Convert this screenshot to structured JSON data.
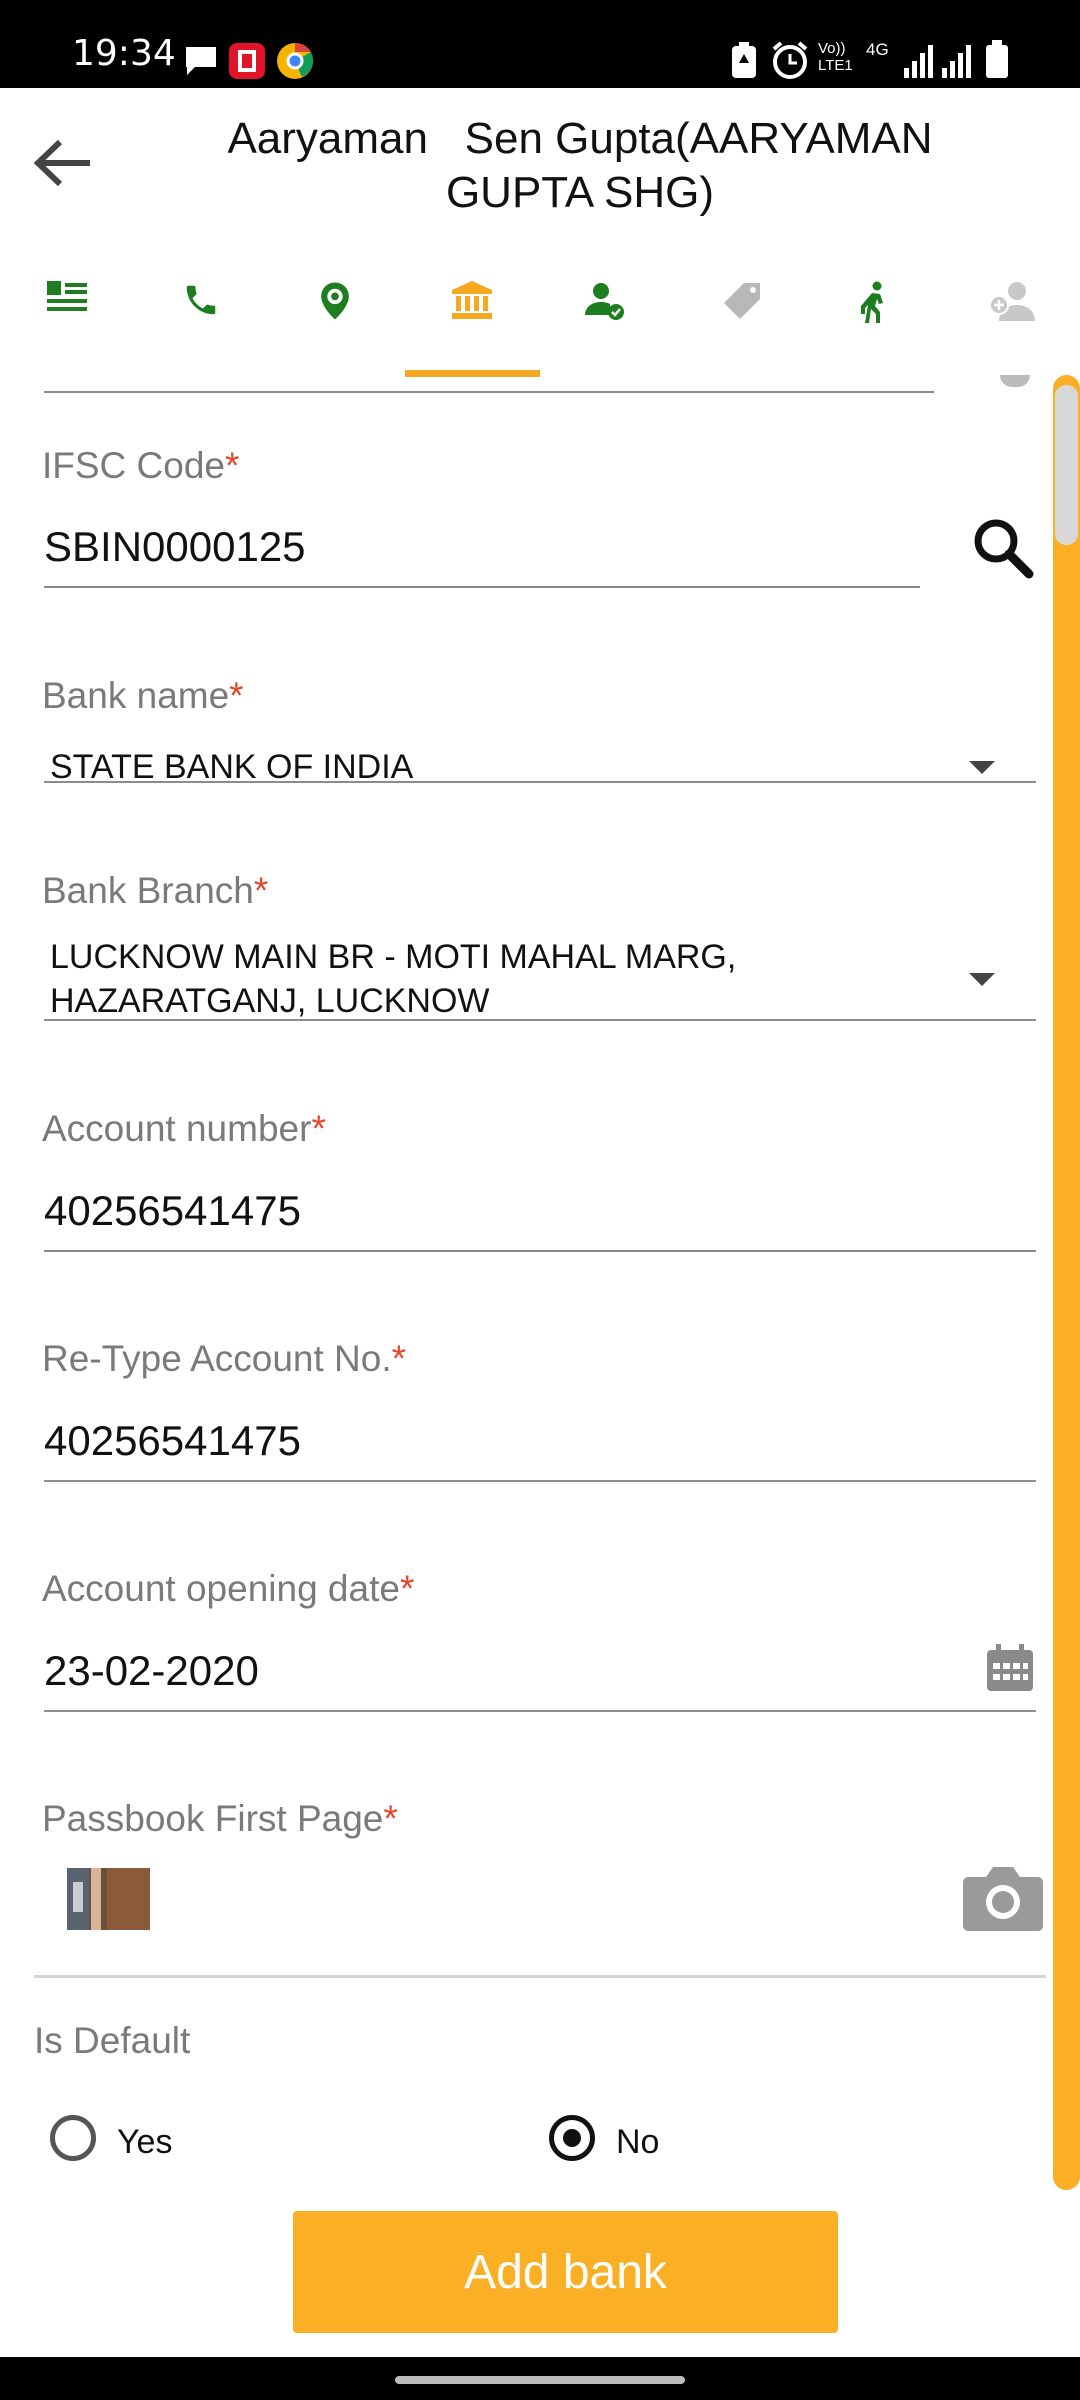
{
  "status_bar": {
    "time": "19:34",
    "icons": [
      "message-icon",
      "kfc-app-icon",
      "chrome-like-icon",
      "battery-saver-icon",
      "alarm-icon",
      "volte-icon",
      "4g-icon",
      "signal-icon",
      "signal-r-icon",
      "battery-icon"
    ],
    "volte_text": "Vo))\nLTE1",
    "network_text": "4G"
  },
  "header": {
    "title_line1": "Aaryaman   Sen Gupta(AARYAMAN",
    "title_line2": "GUPTA SHG)"
  },
  "tabs": [
    {
      "name": "details",
      "icon": "list-icon",
      "active": false
    },
    {
      "name": "phone",
      "icon": "phone-icon",
      "active": false
    },
    {
      "name": "location",
      "icon": "location-pin-icon",
      "active": false
    },
    {
      "name": "bank",
      "icon": "bank-icon",
      "active": true
    },
    {
      "name": "user-verified",
      "icon": "user-check-icon",
      "active": false
    },
    {
      "name": "tag",
      "icon": "tag-icon",
      "active": false
    },
    {
      "name": "activity",
      "icon": "walking-person-icon",
      "active": false
    },
    {
      "name": "add-member",
      "icon": "user-add-icon",
      "active": false
    }
  ],
  "form": {
    "ifsc": {
      "label": "IFSC Code",
      "required": "*",
      "value": "SBIN0000125"
    },
    "bank_name": {
      "label": "Bank name",
      "required": "*",
      "value": "STATE BANK OF INDIA"
    },
    "bank_branch": {
      "label": "Bank Branch",
      "required": "*",
      "value_line1": "LUCKNOW MAIN BR - MOTI MAHAL MARG,",
      "value_line2": "HAZARATGANJ, LUCKNOW"
    },
    "account_number": {
      "label": "Account number",
      "required": "*",
      "value": "40256541475"
    },
    "retype_account": {
      "label": "Re-Type Account No.",
      "required": "*",
      "value": "40256541475"
    },
    "opening_date": {
      "label": "Account opening date",
      "required": "*",
      "value": "23-02-2020"
    },
    "passbook": {
      "label": "Passbook First Page",
      "required": "*"
    },
    "is_default": {
      "label": "Is Default",
      "options": [
        "Yes",
        "No"
      ],
      "selected": "No"
    }
  },
  "actions": {
    "add_bank_label": "Add bank"
  },
  "colors": {
    "accent": "#fbaf25",
    "tab_icon_green": "#1e7d1e",
    "required": "#e5462b"
  }
}
